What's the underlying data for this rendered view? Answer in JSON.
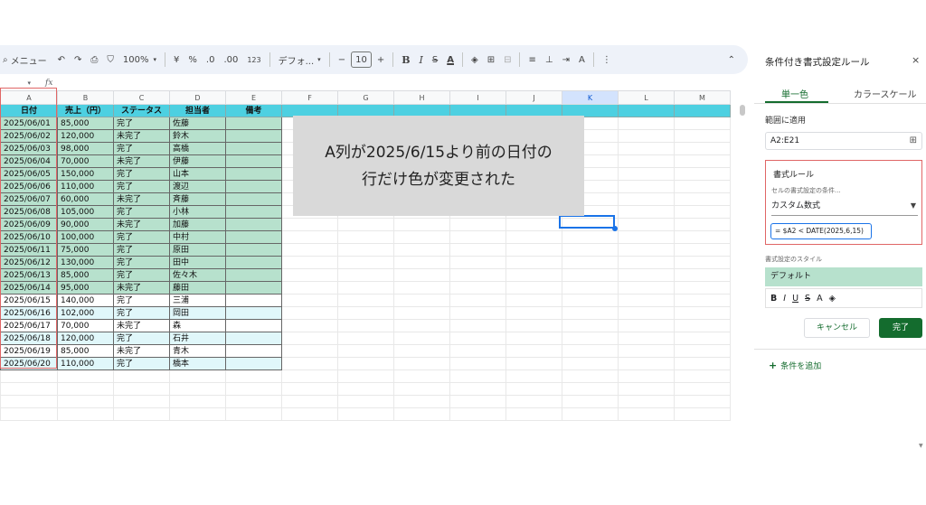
{
  "toolbar": {
    "menu_label": "メニュー",
    "undo": "↶",
    "redo": "↷",
    "print": "⎙",
    "paint_format": "⛉",
    "zoom": "100%",
    "currency": "¥",
    "percent": "%",
    "dec_decrease": ".0",
    "dec_increase": ".00",
    "number_format": "123",
    "font_name": "デフォ...",
    "font_size_minus": "−",
    "font_size": "10",
    "font_size_plus": "+",
    "bold": "B",
    "italic": "I",
    "strike": "S",
    "text_color": "A",
    "fill": "◈",
    "borders": "⊞",
    "merge": "⊟",
    "h_align": "≡",
    "v_align": "⊥",
    "wrap": "⇥",
    "rotate": "A",
    "more": "⋮",
    "collapse": "⌃"
  },
  "formula_bar": {
    "cell_ref": "",
    "fx": "fx"
  },
  "columns": [
    "A",
    "B",
    "C",
    "D",
    "E",
    "F",
    "G",
    "H",
    "I",
    "J",
    "K",
    "L",
    "M"
  ],
  "active_column": "K",
  "sheet": {
    "headers": [
      "日付",
      "売上（円）",
      "ステータス",
      "担当者",
      "備考"
    ],
    "rows": [
      {
        "date": "2025/06/01",
        "sales": "85,000",
        "status": "完了",
        "person": "佐藤",
        "style": "green"
      },
      {
        "date": "2025/06/02",
        "sales": "120,000",
        "status": "未完了",
        "person": "鈴木",
        "style": "green"
      },
      {
        "date": "2025/06/03",
        "sales": "98,000",
        "status": "完了",
        "person": "高橋",
        "style": "green"
      },
      {
        "date": "2025/06/04",
        "sales": "70,000",
        "status": "未完了",
        "person": "伊藤",
        "style": "green"
      },
      {
        "date": "2025/06/05",
        "sales": "150,000",
        "status": "完了",
        "person": "山本",
        "style": "green"
      },
      {
        "date": "2025/06/06",
        "sales": "110,000",
        "status": "完了",
        "person": "渡辺",
        "style": "green"
      },
      {
        "date": "2025/06/07",
        "sales": "60,000",
        "status": "未完了",
        "person": "斉藤",
        "style": "green"
      },
      {
        "date": "2025/06/08",
        "sales": "105,000",
        "status": "完了",
        "person": "小林",
        "style": "green"
      },
      {
        "date": "2025/06/09",
        "sales": "90,000",
        "status": "未完了",
        "person": "加藤",
        "style": "green"
      },
      {
        "date": "2025/06/10",
        "sales": "100,000",
        "status": "完了",
        "person": "中村",
        "style": "green"
      },
      {
        "date": "2025/06/11",
        "sales": "75,000",
        "status": "完了",
        "person": "原田",
        "style": "green"
      },
      {
        "date": "2025/06/12",
        "sales": "130,000",
        "status": "完了",
        "person": "田中",
        "style": "green"
      },
      {
        "date": "2025/06/13",
        "sales": "85,000",
        "status": "完了",
        "person": "佐々木",
        "style": "green"
      },
      {
        "date": "2025/06/14",
        "sales": "95,000",
        "status": "未完了",
        "person": "藤田",
        "style": "green"
      },
      {
        "date": "2025/06/15",
        "sales": "140,000",
        "status": "完了",
        "person": "三浦",
        "style": "white"
      },
      {
        "date": "2025/06/16",
        "sales": "102,000",
        "status": "完了",
        "person": "岡田",
        "style": "cyan"
      },
      {
        "date": "2025/06/17",
        "sales": "70,000",
        "status": "未完了",
        "person": "森",
        "style": "white"
      },
      {
        "date": "2025/06/18",
        "sales": "120,000",
        "status": "完了",
        "person": "石井",
        "style": "cyan"
      },
      {
        "date": "2025/06/19",
        "sales": "85,000",
        "status": "未完了",
        "person": "青木",
        "style": "white"
      },
      {
        "date": "2025/06/20",
        "sales": "110,000",
        "status": "完了",
        "person": "橋本",
        "style": "cyan"
      }
    ]
  },
  "callout": {
    "line1": "A列が2025/6/15より前の日付の",
    "line2": "行だけ色が変更された"
  },
  "panel": {
    "title": "条件付き書式設定ルール",
    "close": "×",
    "tab_single": "単一色",
    "tab_scale": "カラースケール",
    "range_label": "範囲に適用",
    "range_value": "A2:E21",
    "range_icon": "⊞",
    "rules_label": "書式ルール",
    "condition_label": "セルの書式設定の条件...",
    "condition_value": "カスタム数式",
    "formula": "= $A2 < DATE(2025,6,15)",
    "style_label": "書式設定のスタイル",
    "style_preview": "デフォルト",
    "style_bold": "B",
    "style_italic": "I",
    "style_underline": "U",
    "style_strike": "S",
    "style_text_color": "A",
    "style_fill": "◈",
    "cancel": "キャンセル",
    "done": "完了",
    "add_condition": "条件を追加",
    "add_icon": "+"
  },
  "colors": {
    "header": "#4dd0e1",
    "highlight": "#b7e1cd",
    "alt_row": "#e0f7fa",
    "accent": "#146c2e"
  }
}
